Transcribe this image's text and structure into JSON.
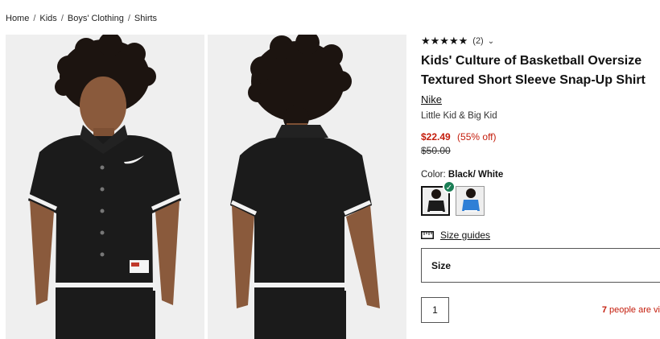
{
  "breadcrumb": {
    "items": [
      "Home",
      "Kids",
      "Boys' Clothing",
      "Shirts"
    ],
    "separator": "/"
  },
  "gallery": {
    "images": [
      {
        "name": "front view",
        "icon": "product-photo-front"
      },
      {
        "name": "back view",
        "icon": "product-photo-back"
      }
    ]
  },
  "product": {
    "stars": "★★★★★",
    "rating_count": "(2)",
    "rating_chevron": "⌄",
    "title": "Kids' Culture of Basketball Oversize Textured Short Sleeve Snap-Up Shirt",
    "brand": "Nike",
    "subtitle": "Little Kid & Big Kid",
    "price": "$22.49",
    "discount": "(55% off)",
    "original_price": "$50.00",
    "color_label": "Color:",
    "color_value": "Black/ White",
    "swatches": [
      {
        "color": "black",
        "selected": true
      },
      {
        "color": "blue",
        "selected": false
      }
    ],
    "size_guide_label": "Size guides",
    "size_label": "Size",
    "quantity": "1",
    "viewers_count": "7",
    "viewers_text": "people are vi"
  },
  "colors": {
    "sale_red": "#c41c0b",
    "check_green": "#1a7e55",
    "text": "#111111"
  }
}
